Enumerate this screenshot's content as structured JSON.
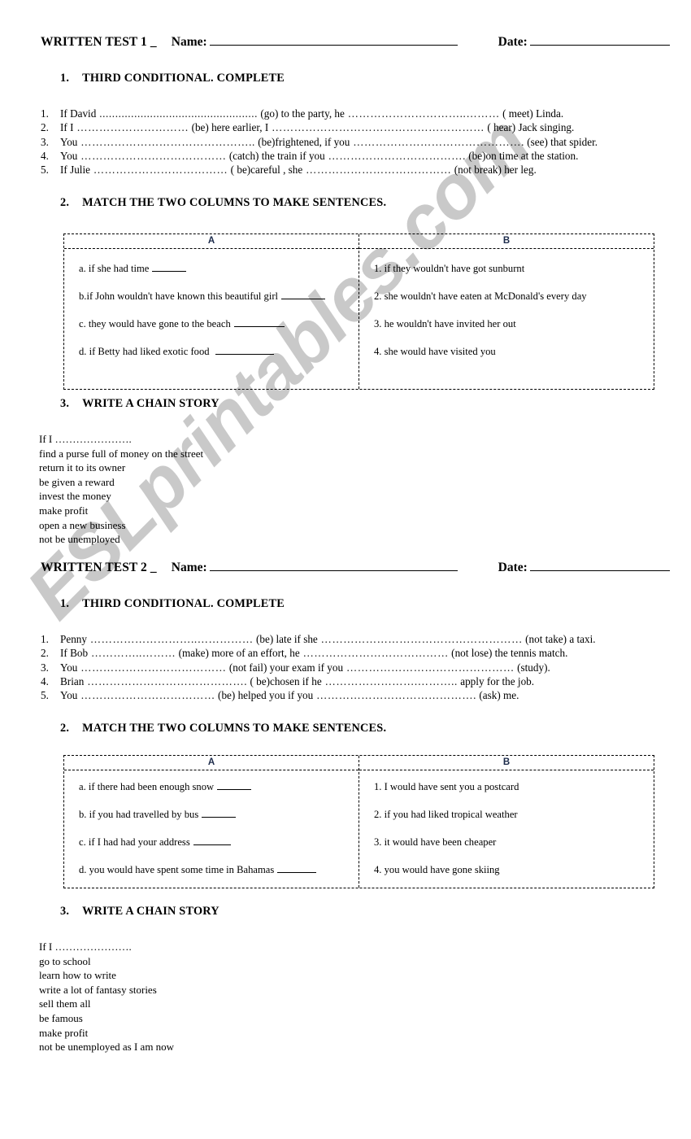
{
  "watermark": {
    "text": "ESLprintables.com",
    "color": "#c9c9c9"
  },
  "tests": [
    {
      "header": {
        "title": "WRITTEN TEST 1 _",
        "name_label": "Name:",
        "name_value": "",
        "date_label": "Date:",
        "date_value": ""
      },
      "section1": {
        "num": "1.",
        "heading": "THIRD CONDITIONAL. COMPLETE",
        "items": [
          {
            "idx": "1.",
            "parts": [
              "If David",
              "..................................................",
              "(go) to the party, he",
              "…………………………..………",
              "( meet) Linda."
            ]
          },
          {
            "idx": "2.",
            "parts": [
              "If I",
              "…………………………",
              "(be)  here earlier, I",
              "…………………………………………………",
              "( hear) Jack singing."
            ]
          },
          {
            "idx": "3.",
            "parts": [
              "You",
              "………………………………………..",
              "(be)frightened, if you",
              "……………………………………….",
              "(see) that spider."
            ]
          },
          {
            "idx": "4.",
            "parts": [
              "You",
              "…………………………………",
              "(catch) the train if you",
              "……………………………….",
              "(be)on time at the station."
            ]
          },
          {
            "idx": "5.",
            "parts": [
              "If Julie",
              "………………………………",
              "( be)careful , she",
              "…………………………………",
              "(not break) her leg."
            ]
          }
        ]
      },
      "section2": {
        "num": "2.",
        "heading": "MATCH THE TWO COLUMNS TO MAKE SENTENCES.",
        "col_a_header": "A",
        "col_b_header": "B",
        "col_a": [
          {
            "text": "a. if she had time",
            "blank_width": 42
          },
          {
            "text": "b.if  John wouldn't have known this beautiful girl",
            "blank_width": 54
          },
          {
            "text": "c. they would have gone to the beach",
            "blank_width": 62
          },
          {
            "text": "d. if Betty had liked exotic food ",
            "blank_width": 72
          }
        ],
        "col_b": [
          {
            "text": "1.  if they wouldn't have got sunburnt",
            "blank_width": 0
          },
          {
            "text": "2. she wouldn't have eaten at McDonald's every day",
            "blank_width": 0
          },
          {
            "text": "3. he wouldn't have invited her out",
            "blank_width": 0
          },
          {
            "text": "4.  she would have visited you",
            "blank_width": 0
          }
        ]
      },
      "section3": {
        "num": "3.",
        "heading": "WRITE A CHAIN STORY",
        "lines": [
          "If I ………………….",
          "find a purse full of money on the street",
          "return it to its owner",
          "be given a reward",
          "invest the money",
          "make profit",
          "open a new business",
          "not be unemployed"
        ]
      }
    },
    {
      "header": {
        "title": "WRITTEN TEST 2 _",
        "name_label": "Name:",
        "name_value": "",
        "date_label": "Date:",
        "date_value": ""
      },
      "section1": {
        "num": "1.",
        "heading": "THIRD CONDITIONAL. COMPLETE",
        "items": [
          {
            "idx": "1.",
            "parts": [
              "Penny",
              "………………………..……………",
              "(be) late if she",
              "………………………………………………",
              "(not take) a taxi."
            ]
          },
          {
            "idx": "2.",
            "parts": [
              "If Bob",
              "…………..………",
              "(make) more of an effort, he",
              "…………………………………",
              "(not lose) the tennis match."
            ]
          },
          {
            "idx": "3.",
            "parts": [
              "You",
              "…………………………………",
              "(not fail) your exam if you",
              "………………………………………",
              "(study)."
            ]
          },
          {
            "idx": "4.",
            "parts": [
              "Brian",
              "…………………………………….",
              "( be)chosen  if he",
              "…………………….………..",
              "apply for the job."
            ]
          },
          {
            "idx": "5.",
            "parts": [
              "You",
              "………………………………",
              "(be) helped you if you",
              "…………………………………….",
              "(ask) me."
            ]
          }
        ]
      },
      "section2": {
        "num": "2.",
        "heading": "MATCH THE TWO COLUMNS TO MAKE SENTENCES.",
        "col_a_header": "A",
        "col_b_header": "B",
        "col_a": [
          {
            "text": "a. if there had been enough snow",
            "blank_width": 42
          },
          {
            "text": "b. if you had travelled by bus",
            "blank_width": 42
          },
          {
            "text": "c. if  I had had your address",
            "blank_width": 46
          },
          {
            "text": "d. you would have spent some time in Bahamas",
            "blank_width": 48
          }
        ],
        "col_b": [
          {
            "text": "1.  I would have sent you a postcard",
            "blank_width": 0
          },
          {
            "text": "2. if you had liked tropical weather",
            "blank_width": 0
          },
          {
            "text": "3. it would have been cheaper",
            "blank_width": 0
          },
          {
            "text": "4. you would have gone skiing",
            "blank_width": 0
          }
        ]
      },
      "section3": {
        "num": "3.",
        "heading": "WRITE A CHAIN STORY",
        "lines": [
          "If I ………………….",
          "go to school",
          "learn how to write",
          "write a lot of fantasy stories",
          "sell them all",
          "be famous",
          "make profit",
          "not be unemployed as I am now"
        ]
      }
    }
  ]
}
